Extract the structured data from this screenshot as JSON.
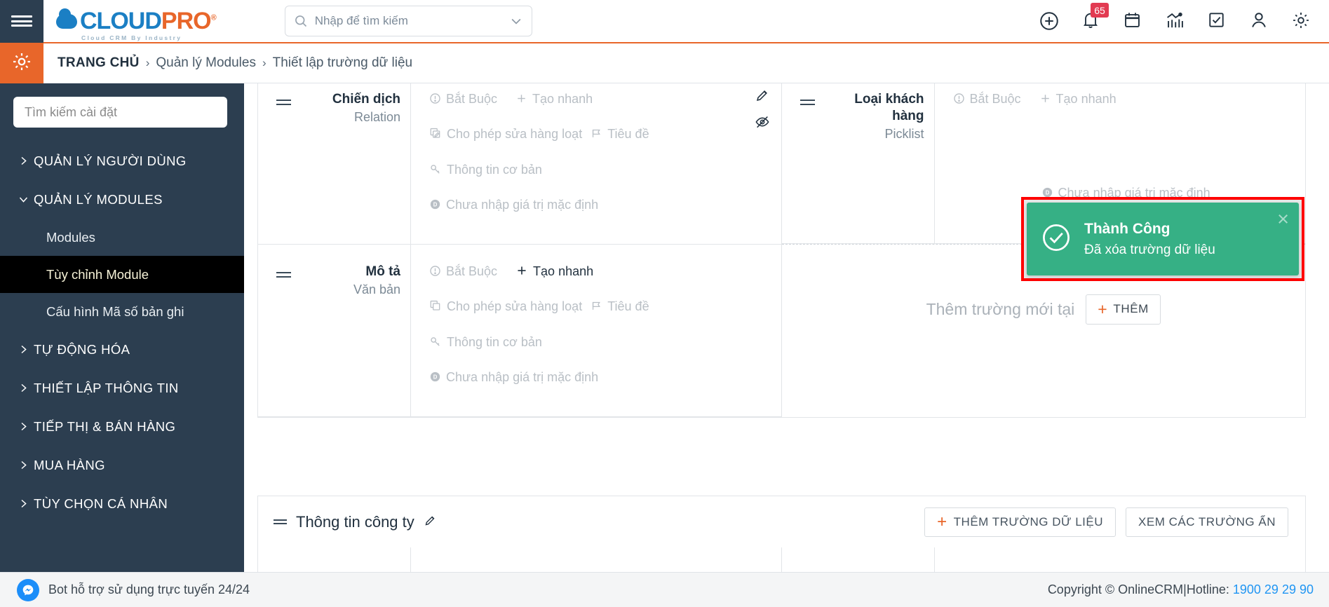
{
  "brand": {
    "name_part1": "CLOUD",
    "name_part2": "PRO",
    "reg": "®",
    "tagline": "Cloud CRM By Industry"
  },
  "search": {
    "placeholder": "Nhập để tìm kiếm",
    "value": ""
  },
  "topbar": {
    "icons": [
      {
        "name": "add-circle-icon",
        "label": "Thêm mới"
      },
      {
        "name": "bell-icon",
        "label": "Thông báo",
        "badge": "65"
      },
      {
        "name": "calendar-icon",
        "label": "Lịch"
      },
      {
        "name": "analytics-icon",
        "label": "Báo cáo"
      },
      {
        "name": "checkbox-icon",
        "label": "Công việc"
      },
      {
        "name": "user-icon",
        "label": "Tài khoản"
      },
      {
        "name": "gear-icon",
        "label": "Cài đặt"
      }
    ]
  },
  "breadcrumb": {
    "home": "TRANG CHỦ",
    "separator": "›",
    "items": [
      "Quản lý Modules",
      "Thiết lập trường dữ liệu"
    ]
  },
  "sidebar": {
    "search_placeholder": "Tìm kiếm cài đặt",
    "items": [
      {
        "label": "QUẢN LÝ NGƯỜI DÙNG",
        "type": "group",
        "expanded": false
      },
      {
        "label": "QUẢN LÝ MODULES",
        "type": "group",
        "expanded": true
      },
      {
        "label": "Modules",
        "type": "sub",
        "active": false
      },
      {
        "label": "Tùy chỉnh Module",
        "type": "sub",
        "active": true
      },
      {
        "label": "Cấu hình Mã số bản ghi",
        "type": "sub",
        "active": false
      },
      {
        "label": "TỰ ĐỘNG HÓA",
        "type": "group",
        "expanded": false
      },
      {
        "label": "THIẾT LẬP THÔNG TIN",
        "type": "group",
        "expanded": false
      },
      {
        "label": "TIẾP THỊ & BÁN HÀNG",
        "type": "group",
        "expanded": false
      },
      {
        "label": "MUA HÀNG",
        "type": "group",
        "expanded": false
      },
      {
        "label": "TÙY CHỌN CÁ NHÂN",
        "type": "group",
        "expanded": false
      }
    ]
  },
  "fields": {
    "left": [
      {
        "title": "Chiến dịch",
        "type": "Relation",
        "props": {
          "required": "Bắt Buộc",
          "quick_create": "Tạo nhanh",
          "mass_edit": "Cho phép sửa hàng loạt",
          "header_field": "Tiêu đề",
          "basic_info": "Thông tin cơ bản",
          "default_value": "Chưa nhập giá trị mặc định"
        },
        "quick_create_enabled": false
      },
      {
        "title": "Mô tả",
        "type": "Văn bản",
        "props": {
          "required": "Bắt Buộc",
          "quick_create": "Tạo nhanh",
          "mass_edit": "Cho phép sửa hàng loạt",
          "header_field": "Tiêu đề",
          "basic_info": "Thông tin cơ bản",
          "default_value": "Chưa nhập giá trị mặc định"
        },
        "quick_create_enabled": true
      }
    ],
    "right": [
      {
        "title": "Loại khách hàng",
        "type": "Picklist",
        "props": {
          "required": "Bắt Buộc",
          "quick_create": "Tạo nhanh",
          "default_value": "Chưa nhập giá trị mặc định"
        },
        "quick_create_enabled": false
      }
    ],
    "add_zone": {
      "label": "Thêm trường mới tại",
      "button": "THÊM",
      "plus": "+"
    }
  },
  "block": {
    "title": "Thông tin công ty",
    "add_field_button": "THÊM TRƯỜNG DỮ LIỆU",
    "show_hidden_button": "XEM CÁC TRƯỜNG ẨN",
    "plus": "+"
  },
  "toast": {
    "title": "Thành Công",
    "message": "Đã xóa trường dữ liệu",
    "close": "×",
    "color": "#36b085",
    "highlight_color": "#ff0000"
  },
  "footer": {
    "chat_label": "Bot hỗ trợ sử dụng trực tuyến 24/24",
    "copyright": "Copyright © OnlineCRM",
    "divider": "|",
    "hotline_label": "Hotline:",
    "hotline": "1900 29 29 90"
  },
  "colors": {
    "accent": "#e8662a",
    "sidebar": "#2c3e50",
    "link": "#2196f3",
    "success": "#36b085"
  }
}
